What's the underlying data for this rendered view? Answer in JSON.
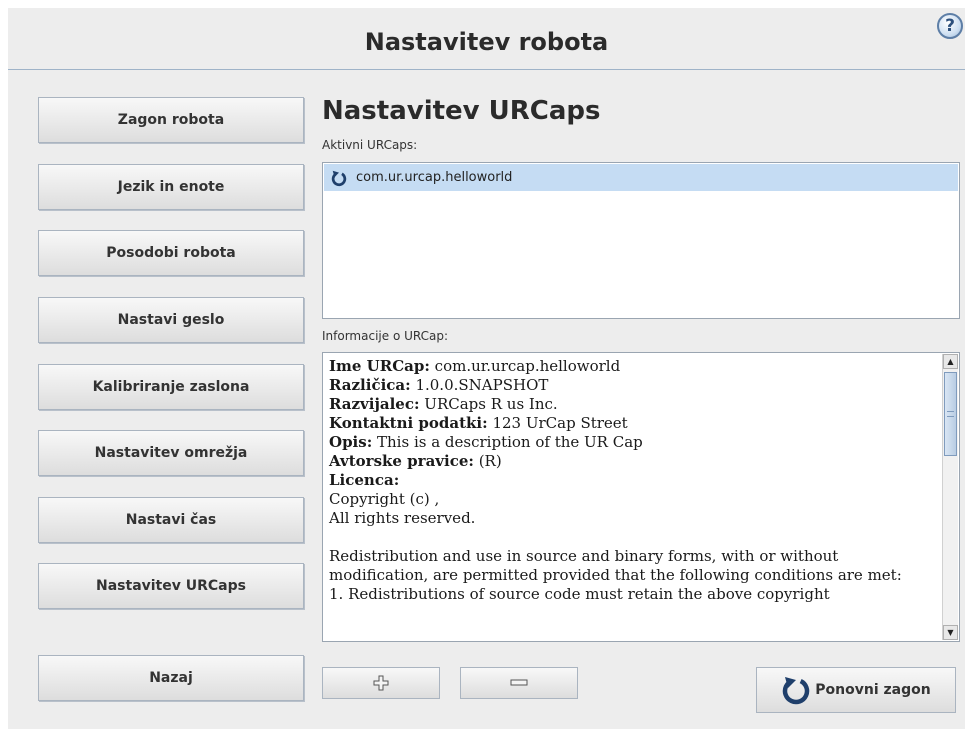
{
  "header": {
    "title": "Nastavitev robota",
    "help_icon": "?"
  },
  "sidebar": {
    "items": [
      {
        "label": "Zagon robota"
      },
      {
        "label": "Jezik in enote"
      },
      {
        "label": "Posodobi robota"
      },
      {
        "label": "Nastavi geslo"
      },
      {
        "label": "Kalibriranje zaslona"
      },
      {
        "label": "Nastavitev omrežja"
      },
      {
        "label": "Nastavi čas"
      },
      {
        "label": "Nastavitev URCaps"
      }
    ],
    "back_label": "Nazaj"
  },
  "main": {
    "title": "Nastavitev URCaps",
    "active_label": "Aktivni URCaps:",
    "active_urcaps": [
      {
        "name": "com.ur.urcap.helloworld"
      }
    ],
    "info_label": "Informacije o URCap:",
    "info": {
      "fields": [
        {
          "key": "Ime URCap",
          "value": " com.ur.urcap.helloworld"
        },
        {
          "key": "Različica",
          "value": " 1.0.0.SNAPSHOT"
        },
        {
          "key": "Razvijalec",
          "value": " URCaps R us Inc."
        },
        {
          "key": "Kontaktni podatki",
          "value": " 123 UrCap Street"
        },
        {
          "key": "Opis",
          "value": " This is a description of the UR Cap"
        },
        {
          "key": "Avtorske pravice",
          "value": " (R)"
        },
        {
          "key": "Licenca",
          "value": ""
        }
      ],
      "license_lines": [
        "Copyright (c) ,",
        "All rights reserved."
      ],
      "paragraph": "Redistribution and use in source and binary forms, with or without modification, are permitted provided that the following conditions are met:",
      "truncated_line": "1. Redistributions of source code must retain the above copyright"
    },
    "add_button": "+",
    "remove_button": "−",
    "restart_label": "Ponovni zagon"
  },
  "colors": {
    "selected_row": "#c5dcf3",
    "panel_bg": "#ededed",
    "icon_blue": "#1f3f6b"
  }
}
